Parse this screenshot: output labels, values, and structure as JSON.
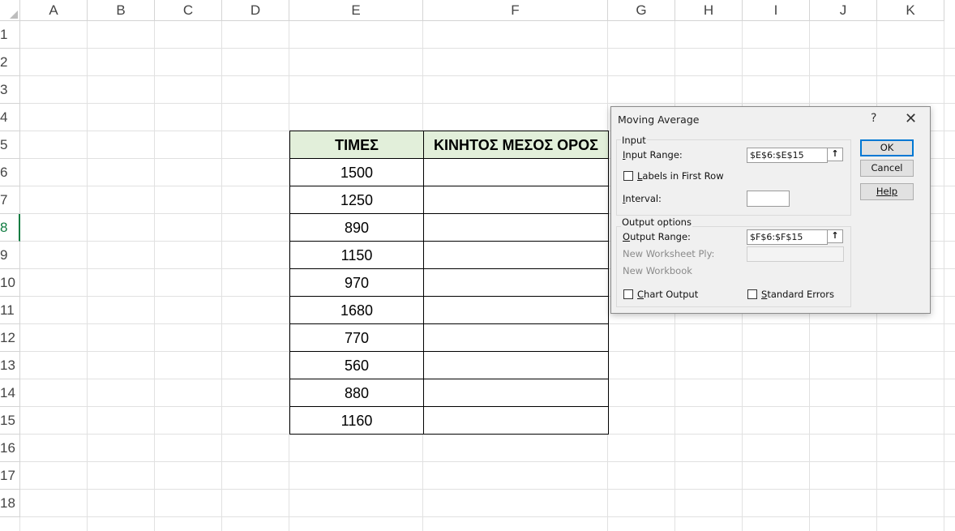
{
  "columns": [
    "A",
    "B",
    "C",
    "D",
    "E",
    "F",
    "G",
    "H",
    "I",
    "J",
    "K"
  ],
  "rows": [
    "1",
    "2",
    "3",
    "4",
    "5",
    "6",
    "7",
    "8",
    "9",
    "10",
    "11",
    "12",
    "13",
    "14",
    "15",
    "16",
    "17",
    "18"
  ],
  "active_row": "8",
  "table": {
    "header_e": "ΤΙΜΕΣ",
    "header_f": "ΚΙΝΗΤΟΣ ΜΕΣΟΣ ΟΡΟΣ",
    "values": [
      "1500",
      "1250",
      "890",
      "1150",
      "970",
      "1680",
      "770",
      "560",
      "880",
      "1160"
    ],
    "header_bg": "#e2efda"
  },
  "dialog": {
    "title": "Moving Average",
    "help_glyph": "?",
    "close_glyph": "✕",
    "input_group": "Input",
    "input_range_label": "Input Range:",
    "input_range_value": "$E$6:$E$15",
    "labels_first_row": "Labels in First Row",
    "interval_label": "Interval:",
    "interval_value": "",
    "output_group": "Output options",
    "output_range_label": "Output Range:",
    "output_range_value": "$F$6:$F$15",
    "new_worksheet": "New Worksheet Ply:",
    "new_workbook": "New Workbook",
    "chart_output": "Chart Output",
    "standard_errors": "Standard Errors",
    "ok": "OK",
    "cancel": "Cancel",
    "help": "Help",
    "ref_icon_glyph": "🠕"
  }
}
